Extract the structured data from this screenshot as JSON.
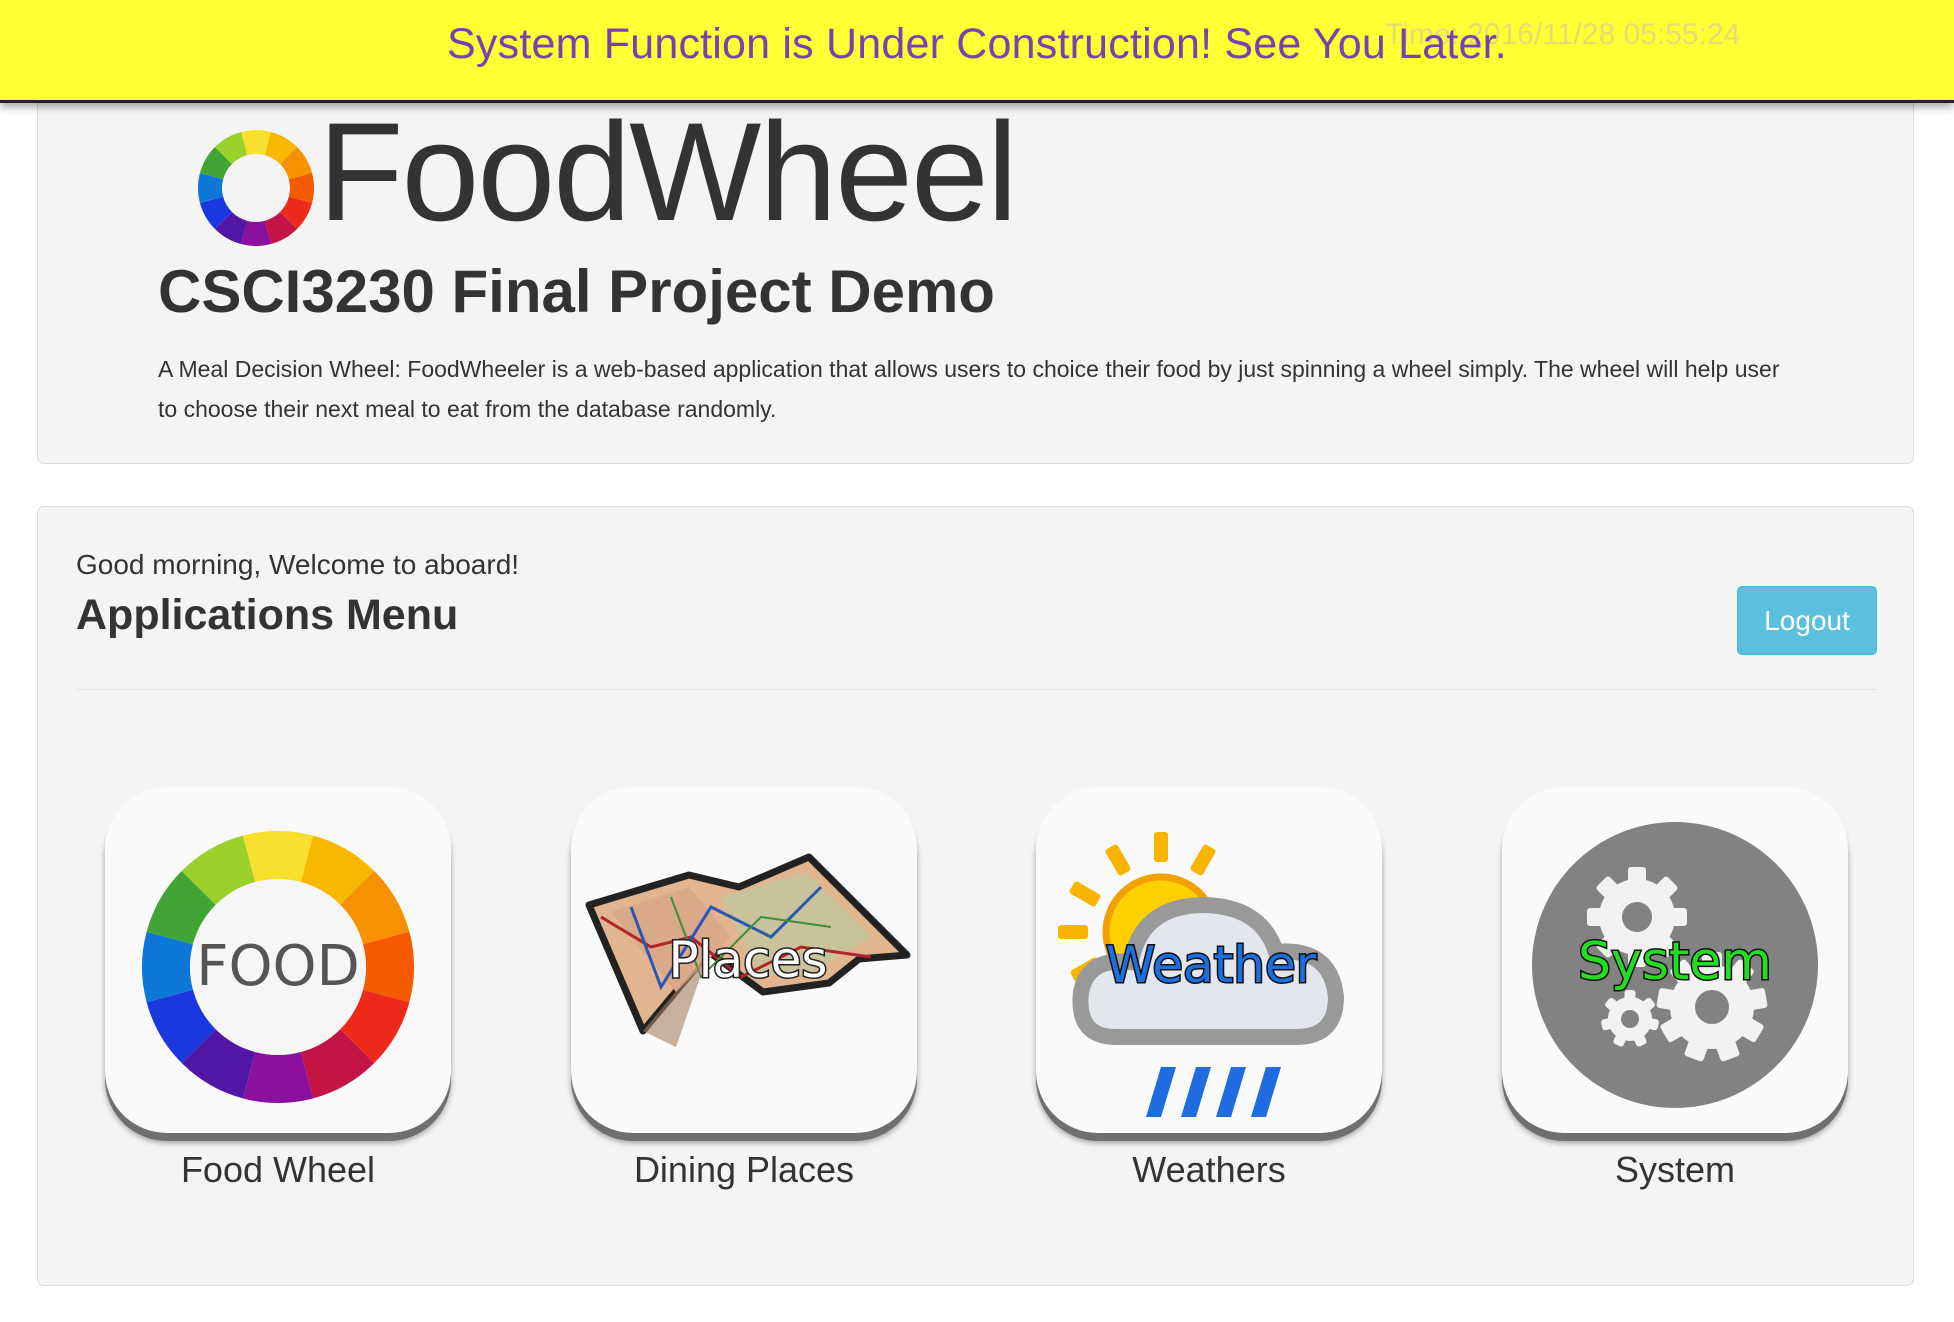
{
  "banner": {
    "message": "System Function is Under Construction! See You Later.",
    "time_text": "Time: 2016/11/28 05:55:24",
    "background_color": "#ffff33",
    "text_color": "#7a3fb0"
  },
  "hero": {
    "brand_name": "FoodWheel",
    "subtitle": "CSCI3230 Final Project Demo",
    "description": "A Meal Decision Wheel: FoodWheeler is a web-based application that allows users to choice their food by just spinning a wheel simply. The wheel will help user to choose their next meal to eat from the database randomly."
  },
  "menu": {
    "greeting": "Good morning, Welcome to aboard!",
    "title": "Applications Menu",
    "logout_label": "Logout",
    "logout_color": "#5bc0de",
    "apps": [
      {
        "label": "Food Wheel",
        "icon_text": "FOOD",
        "icon": "food-wheel-icon"
      },
      {
        "label": "Dining Places",
        "icon_text": "Places",
        "icon": "map-icon"
      },
      {
        "label": "Weathers",
        "icon_text": "Weather",
        "icon": "weather-icon"
      },
      {
        "label": "System",
        "icon_text": "System",
        "icon": "gears-icon"
      }
    ]
  }
}
